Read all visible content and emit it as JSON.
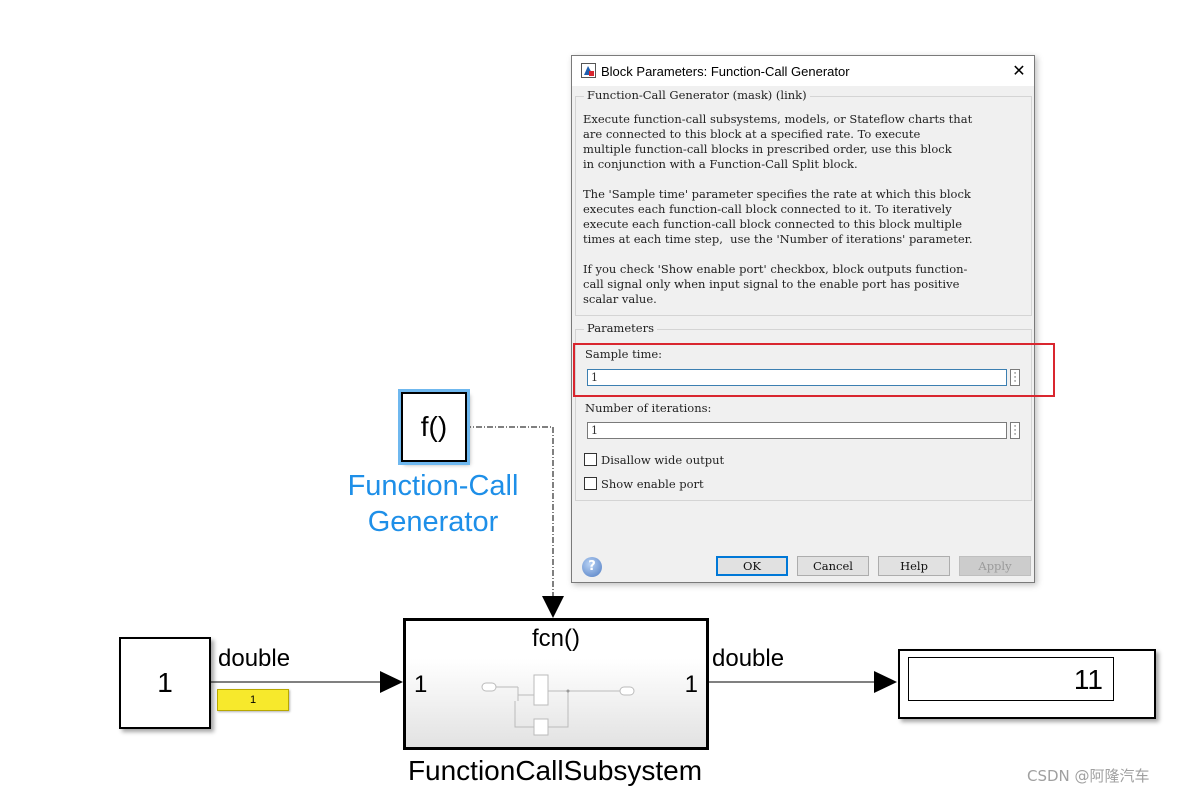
{
  "dialog": {
    "title": "Block Parameters: Function-Call Generator",
    "mask_group_label": "Function-Call Generator (mask) (link)",
    "description_lines": [
      "Execute function-call subsystems, models, or Stateflow charts that",
      "are connected to this block at a specified rate. To execute",
      "multiple function-call blocks in prescribed order, use this block",
      "in conjunction with a Function-Call Split block.",
      "",
      "The 'Sample time' parameter specifies the rate at which this block",
      "executes each function-call block connected to it. To iteratively",
      "execute each function-call block connected to this block multiple",
      "times at each time step,  use the 'Number of iterations' parameter.",
      "",
      "If you check 'Show enable port' checkbox, block outputs function-",
      "call signal only when input signal to the enable port has positive",
      "scalar value."
    ],
    "parameters_group_label": "Parameters",
    "sample_time": {
      "label": "Sample time:",
      "value": "1"
    },
    "num_iterations": {
      "label": "Number of iterations:",
      "value": "1"
    },
    "disallow_wide_output": {
      "label": "Disallow wide output",
      "checked": false
    },
    "show_enable_port": {
      "label": "Show enable port",
      "checked": false
    },
    "buttons": {
      "ok": "OK",
      "cancel": "Cancel",
      "help": "Help",
      "apply": "Apply"
    },
    "highlight_color": "#d9262f"
  },
  "model": {
    "function_call_generator": {
      "glyph": "f()",
      "name_line1": "Function-Call",
      "name_line2": "Generator",
      "name_color": "#1e8fe8"
    },
    "constant": {
      "value": "1"
    },
    "input_signal": {
      "type_label": "double",
      "port_value": "1"
    },
    "subsystem": {
      "title": "fcn()",
      "in_port": "1",
      "out_port": "1",
      "name": "FunctionCallSubsystem"
    },
    "output_signal": {
      "type_label": "double"
    },
    "display": {
      "value": "11"
    }
  },
  "watermark": "CSDN @阿隆汽车",
  "icons": [
    "matlab-app-icon",
    "close-icon",
    "help-icon",
    "ellipsis-icon"
  ]
}
